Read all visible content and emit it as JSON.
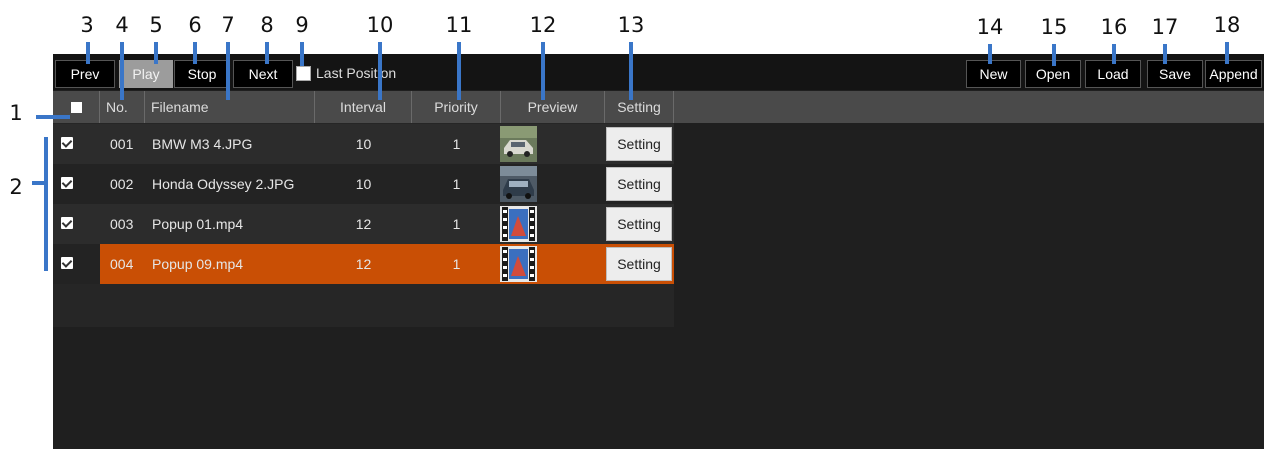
{
  "callouts": [
    "1",
    "2",
    "3",
    "4",
    "5",
    "6",
    "7",
    "8",
    "9",
    "10",
    "11",
    "12",
    "13",
    "14",
    "15",
    "16",
    "17",
    "18"
  ],
  "toolbar": {
    "prev_label": "Prev",
    "play_label": "Play",
    "stop_label": "Stop",
    "next_label": "Next",
    "last_position_label": "Last Position",
    "new_label": "New",
    "open_label": "Open",
    "load_label": "Load",
    "save_label": "Save",
    "append_label": "Append"
  },
  "grid": {
    "columns": {
      "no": "No.",
      "filename": "Filename",
      "interval": "Interval",
      "priority": "Priority",
      "preview": "Preview",
      "setting": "Setting"
    },
    "rows": [
      {
        "checked": true,
        "no": "001",
        "filename": "BMW M3 4.JPG",
        "interval": "10",
        "priority": "1",
        "preview": "car-photo-icon",
        "setting": "Setting",
        "selected": false
      },
      {
        "checked": true,
        "no": "002",
        "filename": "Honda Odyssey 2.JPG",
        "interval": "10",
        "priority": "1",
        "preview": "car-photo-icon",
        "setting": "Setting",
        "selected": false
      },
      {
        "checked": true,
        "no": "003",
        "filename": "Popup 01.mp4",
        "interval": "12",
        "priority": "1",
        "preview": "video-file-icon",
        "setting": "Setting",
        "selected": false
      },
      {
        "checked": true,
        "no": "004",
        "filename": "Popup 09.mp4",
        "interval": "12",
        "priority": "1",
        "preview": "video-file-icon",
        "setting": "Setting",
        "selected": true
      }
    ]
  },
  "colors": {
    "selection": "#c94f05",
    "callout_line": "#3a76c8",
    "background": "#1f1f1f"
  }
}
